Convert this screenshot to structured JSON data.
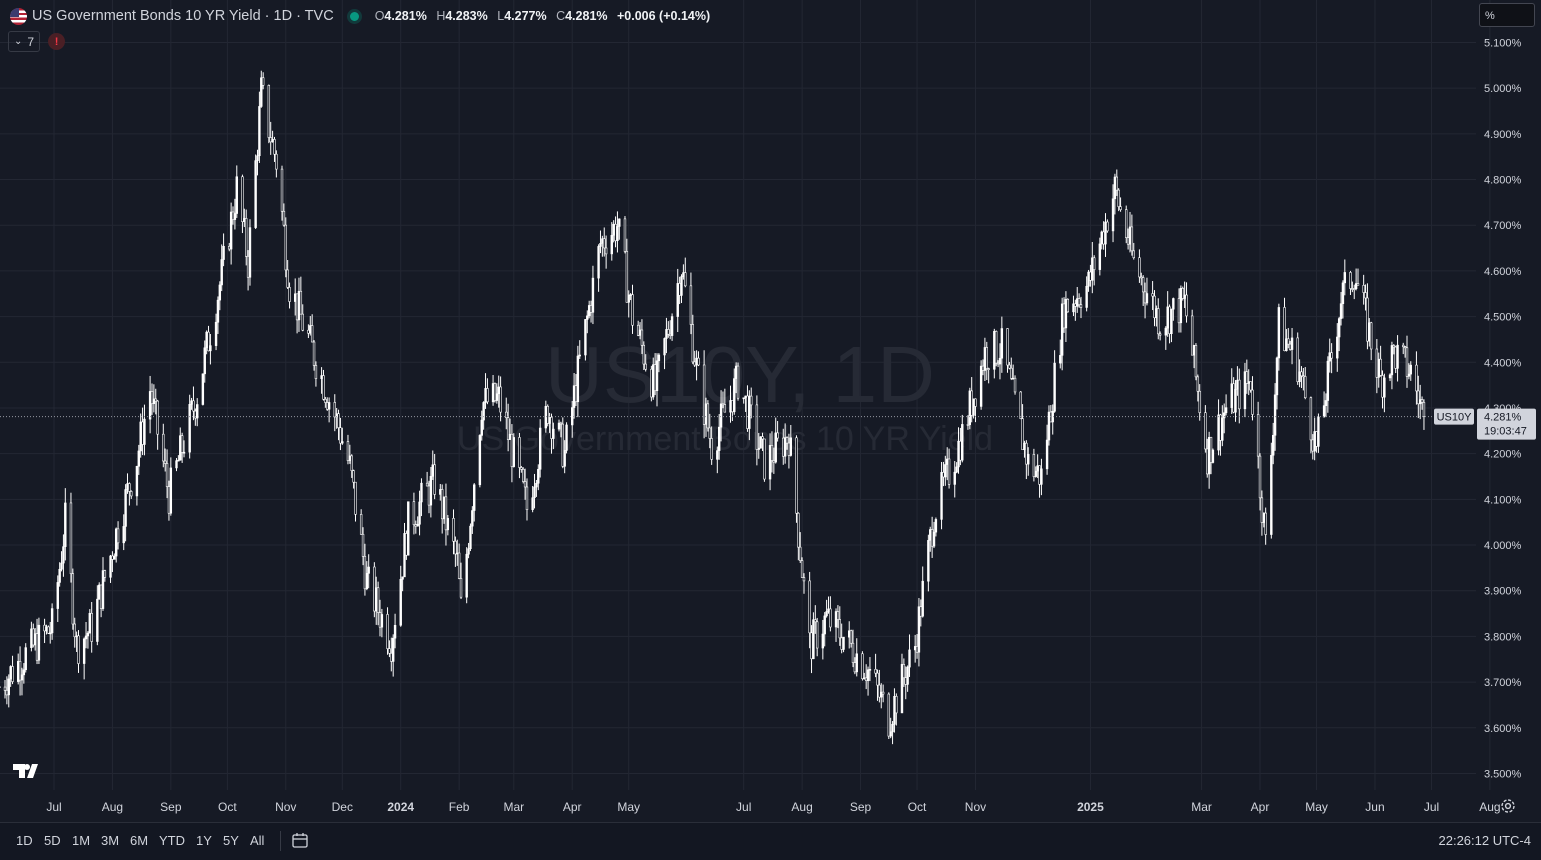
{
  "header": {
    "title": "US Government Bonds 10 YR Yield · 1D · TVC",
    "ohlc": {
      "o_label": "O",
      "o": "4.281%",
      "h_label": "H",
      "h": "4.283%",
      "l_label": "L",
      "l": "4.277%",
      "c_label": "C",
      "c": "4.281%",
      "change": "+0.006 (+0.14%)"
    }
  },
  "indicators_badge": {
    "count": "7",
    "alert": "!"
  },
  "unit_selector": {
    "value": "%"
  },
  "watermark": {
    "symbol": "US10Y, 1D",
    "name": "US Government Bonds 10 YR Yield"
  },
  "price_label": {
    "ticker": "US10Y",
    "price": "4.281%",
    "countdown": "19:03:47"
  },
  "time_ranges": [
    "1D",
    "5D",
    "1M",
    "3M",
    "6M",
    "YTD",
    "1Y",
    "5Y",
    "All"
  ],
  "clock": "22:26:12 UTC-4",
  "colors": {
    "background": "#161a25",
    "candles": "#ffffff",
    "accent": "#089981",
    "alert": "#f23645"
  },
  "icons": [
    "us-flag-icon",
    "chevron-down-icon",
    "alert-icon",
    "tradingview-logo-icon",
    "calendar-range-icon",
    "settings-icon"
  ],
  "chart_data": {
    "type": "candlestick",
    "y_unit": "%",
    "y_ticks": [
      "5.100%",
      "5.000%",
      "4.900%",
      "4.800%",
      "4.700%",
      "4.600%",
      "4.500%",
      "4.400%",
      "4.300%",
      "4.200%",
      "4.100%",
      "4.000%",
      "3.900%",
      "3.800%",
      "3.700%",
      "3.600%",
      "3.500%"
    ],
    "ylim": [
      3.48,
      5.12
    ],
    "x_ticks": [
      {
        "label": "Jul",
        "date": "2023-07-01",
        "bold": false
      },
      {
        "label": "Aug",
        "date": "2023-08-01",
        "bold": false
      },
      {
        "label": "Sep",
        "date": "2023-09-01",
        "bold": false
      },
      {
        "label": "Oct",
        "date": "2023-10-01",
        "bold": false
      },
      {
        "label": "Nov",
        "date": "2023-11-01",
        "bold": false
      },
      {
        "label": "Dec",
        "date": "2023-12-01",
        "bold": false
      },
      {
        "label": "2024",
        "date": "2024-01-01",
        "bold": true
      },
      {
        "label": "Feb",
        "date": "2024-02-01",
        "bold": false
      },
      {
        "label": "Mar",
        "date": "2024-03-01",
        "bold": false
      },
      {
        "label": "Apr",
        "date": "2024-04-01",
        "bold": false
      },
      {
        "label": "May",
        "date": "2024-05-01",
        "bold": false
      },
      {
        "label": "Jul",
        "date": "2024-07-01",
        "bold": false
      },
      {
        "label": "Aug",
        "date": "2024-08-01",
        "bold": false
      },
      {
        "label": "Sep",
        "date": "2024-09-01",
        "bold": false
      },
      {
        "label": "Oct",
        "date": "2024-10-01",
        "bold": false
      },
      {
        "label": "Nov",
        "date": "2024-11-01",
        "bold": false
      },
      {
        "label": "2025",
        "date": "2025-01-01",
        "bold": true
      },
      {
        "label": "Mar",
        "date": "2025-03-01",
        "bold": false
      },
      {
        "label": "Apr",
        "date": "2025-04-01",
        "bold": false
      },
      {
        "label": "May",
        "date": "2025-05-01",
        "bold": false
      },
      {
        "label": "Jun",
        "date": "2025-06-01",
        "bold": false
      },
      {
        "label": "Jul",
        "date": "2025-07-01",
        "bold": false
      },
      {
        "label": "Aug",
        "date": "2025-08-01",
        "bold": false
      }
    ],
    "x_range": [
      "2023-06-01",
      "2025-08-06"
    ],
    "last_price": 4.281,
    "close_path": [
      {
        "date": "2023-06-02",
        "close": 3.69
      },
      {
        "date": "2023-06-16",
        "close": 3.76
      },
      {
        "date": "2023-06-30",
        "close": 3.82
      },
      {
        "date": "2023-07-07",
        "close": 4.05
      },
      {
        "date": "2023-07-13",
        "close": 3.78
      },
      {
        "date": "2023-07-21",
        "close": 3.82
      },
      {
        "date": "2023-08-04",
        "close": 4.04
      },
      {
        "date": "2023-08-14",
        "close": 4.19
      },
      {
        "date": "2023-08-21",
        "close": 4.34
      },
      {
        "date": "2023-08-31",
        "close": 4.11
      },
      {
        "date": "2023-09-15",
        "close": 4.33
      },
      {
        "date": "2023-09-28",
        "close": 4.59
      },
      {
        "date": "2023-10-06",
        "close": 4.78
      },
      {
        "date": "2023-10-12",
        "close": 4.62
      },
      {
        "date": "2023-10-19",
        "close": 4.99
      },
      {
        "date": "2023-10-27",
        "close": 4.84
      },
      {
        "date": "2023-11-03",
        "close": 4.57
      },
      {
        "date": "2023-11-14",
        "close": 4.44
      },
      {
        "date": "2023-11-29",
        "close": 4.26
      },
      {
        "date": "2023-12-05",
        "close": 4.17
      },
      {
        "date": "2023-12-14",
        "close": 3.92
      },
      {
        "date": "2023-12-27",
        "close": 3.79
      },
      {
        "date": "2024-01-05",
        "close": 4.05
      },
      {
        "date": "2024-01-19",
        "close": 4.14
      },
      {
        "date": "2024-01-31",
        "close": 3.96
      },
      {
        "date": "2024-02-02",
        "close": 3.86
      },
      {
        "date": "2024-02-13",
        "close": 4.31
      },
      {
        "date": "2024-02-22",
        "close": 4.32
      },
      {
        "date": "2024-03-08",
        "close": 4.08
      },
      {
        "date": "2024-03-19",
        "close": 4.3
      },
      {
        "date": "2024-03-28",
        "close": 4.2
      },
      {
        "date": "2024-04-05",
        "close": 4.4
      },
      {
        "date": "2024-04-16",
        "close": 4.66
      },
      {
        "date": "2024-04-25",
        "close": 4.7
      },
      {
        "date": "2024-05-03",
        "close": 4.5
      },
      {
        "date": "2024-05-15",
        "close": 4.34
      },
      {
        "date": "2024-05-29",
        "close": 4.61
      },
      {
        "date": "2024-06-07",
        "close": 4.36
      },
      {
        "date": "2024-06-14",
        "close": 4.22
      },
      {
        "date": "2024-06-28",
        "close": 4.36
      },
      {
        "date": "2024-07-12",
        "close": 4.18
      },
      {
        "date": "2024-07-25",
        "close": 4.24
      },
      {
        "date": "2024-08-05",
        "close": 3.78
      },
      {
        "date": "2024-08-14",
        "close": 3.84
      },
      {
        "date": "2024-08-23",
        "close": 3.8
      },
      {
        "date": "2024-09-06",
        "close": 3.72
      },
      {
        "date": "2024-09-16",
        "close": 3.62
      },
      {
        "date": "2024-09-30",
        "close": 3.78
      },
      {
        "date": "2024-10-10",
        "close": 4.07
      },
      {
        "date": "2024-10-25",
        "close": 4.24
      },
      {
        "date": "2024-11-06",
        "close": 4.42
      },
      {
        "date": "2024-11-15",
        "close": 4.43
      },
      {
        "date": "2024-11-29",
        "close": 4.18
      },
      {
        "date": "2024-12-06",
        "close": 4.15
      },
      {
        "date": "2024-12-18",
        "close": 4.52
      },
      {
        "date": "2024-12-31",
        "close": 4.57
      },
      {
        "date": "2025-01-14",
        "close": 4.78
      },
      {
        "date": "2025-01-24",
        "close": 4.62
      },
      {
        "date": "2025-02-07",
        "close": 4.49
      },
      {
        "date": "2025-02-20",
        "close": 4.53
      },
      {
        "date": "2025-03-04",
        "close": 4.2
      },
      {
        "date": "2025-03-14",
        "close": 4.3
      },
      {
        "date": "2025-03-27",
        "close": 4.36
      },
      {
        "date": "2025-04-04",
        "close": 4.0
      },
      {
        "date": "2025-04-11",
        "close": 4.48
      },
      {
        "date": "2025-04-21",
        "close": 4.4
      },
      {
        "date": "2025-05-01",
        "close": 4.21
      },
      {
        "date": "2025-05-14",
        "close": 4.54
      },
      {
        "date": "2025-05-21",
        "close": 4.6
      },
      {
        "date": "2025-06-04",
        "close": 4.36
      },
      {
        "date": "2025-06-11",
        "close": 4.42
      },
      {
        "date": "2025-06-20",
        "close": 4.38
      },
      {
        "date": "2025-06-27",
        "close": 4.28
      }
    ]
  }
}
